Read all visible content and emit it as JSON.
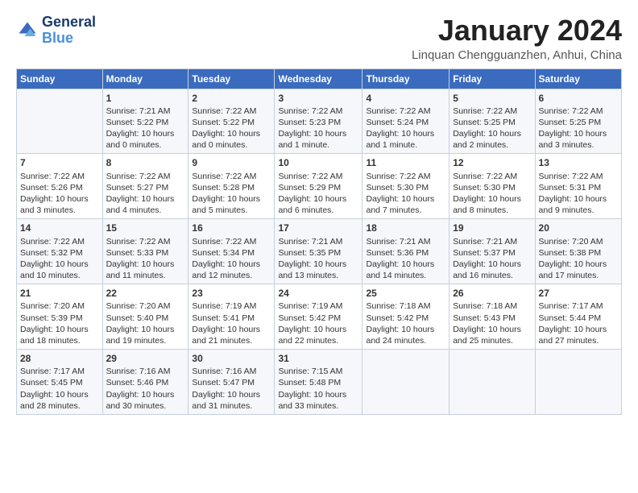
{
  "header": {
    "logo_line1": "General",
    "logo_line2": "Blue",
    "title": "January 2024",
    "subtitle": "Linquan Chengguanzhen, Anhui, China"
  },
  "days_of_week": [
    "Sunday",
    "Monday",
    "Tuesday",
    "Wednesday",
    "Thursday",
    "Friday",
    "Saturday"
  ],
  "weeks": [
    [
      {
        "day": "",
        "info": ""
      },
      {
        "day": "1",
        "info": "Sunrise: 7:21 AM\nSunset: 5:22 PM\nDaylight: 10 hours\nand 0 minutes."
      },
      {
        "day": "2",
        "info": "Sunrise: 7:22 AM\nSunset: 5:22 PM\nDaylight: 10 hours\nand 0 minutes."
      },
      {
        "day": "3",
        "info": "Sunrise: 7:22 AM\nSunset: 5:23 PM\nDaylight: 10 hours\nand 1 minute."
      },
      {
        "day": "4",
        "info": "Sunrise: 7:22 AM\nSunset: 5:24 PM\nDaylight: 10 hours\nand 1 minute."
      },
      {
        "day": "5",
        "info": "Sunrise: 7:22 AM\nSunset: 5:25 PM\nDaylight: 10 hours\nand 2 minutes."
      },
      {
        "day": "6",
        "info": "Sunrise: 7:22 AM\nSunset: 5:25 PM\nDaylight: 10 hours\nand 3 minutes."
      }
    ],
    [
      {
        "day": "7",
        "info": "Sunrise: 7:22 AM\nSunset: 5:26 PM\nDaylight: 10 hours\nand 3 minutes."
      },
      {
        "day": "8",
        "info": "Sunrise: 7:22 AM\nSunset: 5:27 PM\nDaylight: 10 hours\nand 4 minutes."
      },
      {
        "day": "9",
        "info": "Sunrise: 7:22 AM\nSunset: 5:28 PM\nDaylight: 10 hours\nand 5 minutes."
      },
      {
        "day": "10",
        "info": "Sunrise: 7:22 AM\nSunset: 5:29 PM\nDaylight: 10 hours\nand 6 minutes."
      },
      {
        "day": "11",
        "info": "Sunrise: 7:22 AM\nSunset: 5:30 PM\nDaylight: 10 hours\nand 7 minutes."
      },
      {
        "day": "12",
        "info": "Sunrise: 7:22 AM\nSunset: 5:30 PM\nDaylight: 10 hours\nand 8 minutes."
      },
      {
        "day": "13",
        "info": "Sunrise: 7:22 AM\nSunset: 5:31 PM\nDaylight: 10 hours\nand 9 minutes."
      }
    ],
    [
      {
        "day": "14",
        "info": "Sunrise: 7:22 AM\nSunset: 5:32 PM\nDaylight: 10 hours\nand 10 minutes."
      },
      {
        "day": "15",
        "info": "Sunrise: 7:22 AM\nSunset: 5:33 PM\nDaylight: 10 hours\nand 11 minutes."
      },
      {
        "day": "16",
        "info": "Sunrise: 7:22 AM\nSunset: 5:34 PM\nDaylight: 10 hours\nand 12 minutes."
      },
      {
        "day": "17",
        "info": "Sunrise: 7:21 AM\nSunset: 5:35 PM\nDaylight: 10 hours\nand 13 minutes."
      },
      {
        "day": "18",
        "info": "Sunrise: 7:21 AM\nSunset: 5:36 PM\nDaylight: 10 hours\nand 14 minutes."
      },
      {
        "day": "19",
        "info": "Sunrise: 7:21 AM\nSunset: 5:37 PM\nDaylight: 10 hours\nand 16 minutes."
      },
      {
        "day": "20",
        "info": "Sunrise: 7:20 AM\nSunset: 5:38 PM\nDaylight: 10 hours\nand 17 minutes."
      }
    ],
    [
      {
        "day": "21",
        "info": "Sunrise: 7:20 AM\nSunset: 5:39 PM\nDaylight: 10 hours\nand 18 minutes."
      },
      {
        "day": "22",
        "info": "Sunrise: 7:20 AM\nSunset: 5:40 PM\nDaylight: 10 hours\nand 19 minutes."
      },
      {
        "day": "23",
        "info": "Sunrise: 7:19 AM\nSunset: 5:41 PM\nDaylight: 10 hours\nand 21 minutes."
      },
      {
        "day": "24",
        "info": "Sunrise: 7:19 AM\nSunset: 5:42 PM\nDaylight: 10 hours\nand 22 minutes."
      },
      {
        "day": "25",
        "info": "Sunrise: 7:18 AM\nSunset: 5:42 PM\nDaylight: 10 hours\nand 24 minutes."
      },
      {
        "day": "26",
        "info": "Sunrise: 7:18 AM\nSunset: 5:43 PM\nDaylight: 10 hours\nand 25 minutes."
      },
      {
        "day": "27",
        "info": "Sunrise: 7:17 AM\nSunset: 5:44 PM\nDaylight: 10 hours\nand 27 minutes."
      }
    ],
    [
      {
        "day": "28",
        "info": "Sunrise: 7:17 AM\nSunset: 5:45 PM\nDaylight: 10 hours\nand 28 minutes."
      },
      {
        "day": "29",
        "info": "Sunrise: 7:16 AM\nSunset: 5:46 PM\nDaylight: 10 hours\nand 30 minutes."
      },
      {
        "day": "30",
        "info": "Sunrise: 7:16 AM\nSunset: 5:47 PM\nDaylight: 10 hours\nand 31 minutes."
      },
      {
        "day": "31",
        "info": "Sunrise: 7:15 AM\nSunset: 5:48 PM\nDaylight: 10 hours\nand 33 minutes."
      },
      {
        "day": "",
        "info": ""
      },
      {
        "day": "",
        "info": ""
      },
      {
        "day": "",
        "info": ""
      }
    ]
  ]
}
